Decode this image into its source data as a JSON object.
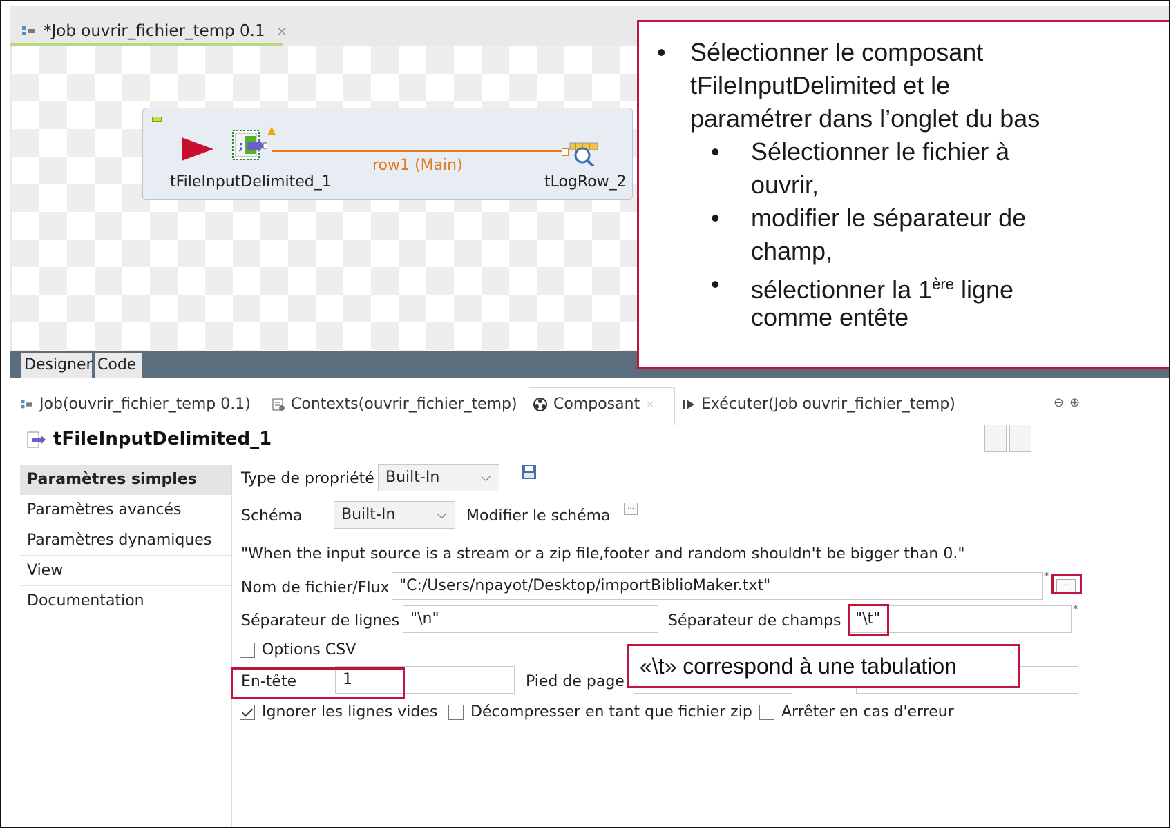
{
  "editor": {
    "tab_label": "*Job ouvrir_fichier_temp 0.1",
    "tab_close": "×"
  },
  "canvas": {
    "component1_label": "tFileInputDelimited_1",
    "component2_label": "tLogRow_2",
    "link_label": "row1 (Main)"
  },
  "designer_tabs": [
    "Designer",
    "Code"
  ],
  "annotation": {
    "bullet": "•",
    "main_text_lines": [
      "Sélectionner le composant",
      "tFileInputDelimited et le",
      "paramétrer dans l’onglet du bas"
    ],
    "sub1_lines": [
      "Sélectionner le fichier à",
      "ouvrir,"
    ],
    "sub2_lines": [
      "modifier le séparateur de",
      "champ,"
    ],
    "sub3_prefix": "sélectionner la 1",
    "sub3_sup": "ère",
    "sub3_suffix": " ligne",
    "sub3_line2": "comme entête"
  },
  "views_tabs": {
    "job": "Job(ouvrir_fichier_temp 0.1)",
    "contexts": "Contexts(ouvrir_fichier_temp)",
    "composant": "Composant",
    "executer": "Exécuter(Job ouvrir_fichier_temp)"
  },
  "component_title": "tFileInputDelimited_1",
  "side_nav": [
    "Paramètres simples",
    "Paramètres avancés",
    "Paramètres dynamiques",
    "View",
    "Documentation"
  ],
  "form": {
    "property_type_label": "Type de propriété",
    "property_type_value": "Built-In",
    "schema_label": "Schéma",
    "schema_value": "Built-In",
    "edit_schema_label": "Modifier le schéma",
    "warning_text": "\"When the input source is a stream or a zip file,footer and random shouldn't be bigger than 0.\"",
    "filename_label": "Nom de fichier/Flux",
    "filename_value": "\"C:/Users/npayot/Desktop/importBiblioMaker.txt\"",
    "row_sep_label": "Séparateur de lignes",
    "row_sep_value": "\"\\n\"",
    "field_sep_label": "Séparateur de champs",
    "field_sep_value": "\"\\t\"",
    "csv_options_label": "Options CSV",
    "header_label": "En-tête",
    "header_value": "1",
    "footer_label": "Pied de page",
    "skip_empty_label": "Ignorer les lignes vides",
    "uncompress_label": "Décompresser en tant que fichier zip",
    "die_on_error_label": "Arrêter en cas d'erreur",
    "browse_label": "..."
  },
  "callout": "«\\t» correspond à une tabulation",
  "colors": {
    "annotation_border": "#c0143c",
    "link": "#e07b1f",
    "start_arrow": "#c8102e",
    "tab_underline": "#b9d879"
  }
}
